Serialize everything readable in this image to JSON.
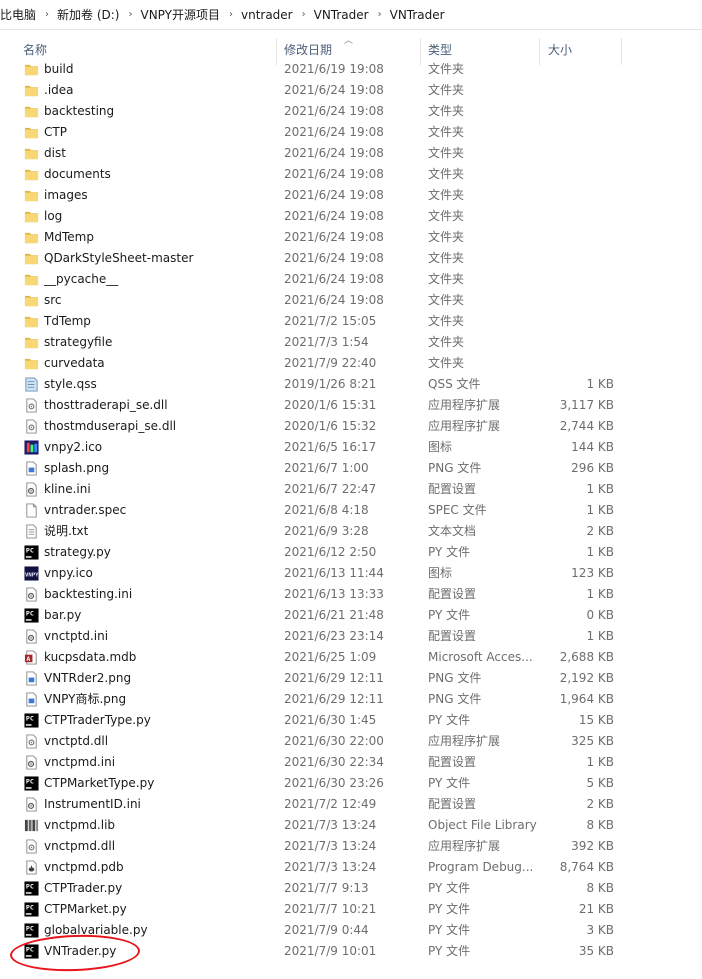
{
  "breadcrumb": [
    "比电脑",
    "新加卷 (D:)",
    "VNPY开源项目",
    "vntrader",
    "VNTrader",
    "VNTrader"
  ],
  "columns": {
    "name": "名称",
    "date": "修改日期",
    "type": "类型",
    "size": "大小"
  },
  "files": [
    {
      "name": "build",
      "date": "2021/6/19 19:08",
      "type": "文件夹",
      "size": "",
      "icon": "folder-icon"
    },
    {
      "name": ".idea",
      "date": "2021/6/24 19:08",
      "type": "文件夹",
      "size": "",
      "icon": "folder-icon"
    },
    {
      "name": "backtesting",
      "date": "2021/6/24 19:08",
      "type": "文件夹",
      "size": "",
      "icon": "folder-icon"
    },
    {
      "name": "CTP",
      "date": "2021/6/24 19:08",
      "type": "文件夹",
      "size": "",
      "icon": "folder-icon"
    },
    {
      "name": "dist",
      "date": "2021/6/24 19:08",
      "type": "文件夹",
      "size": "",
      "icon": "folder-icon"
    },
    {
      "name": "documents",
      "date": "2021/6/24 19:08",
      "type": "文件夹",
      "size": "",
      "icon": "folder-icon"
    },
    {
      "name": "images",
      "date": "2021/6/24 19:08",
      "type": "文件夹",
      "size": "",
      "icon": "folder-icon"
    },
    {
      "name": "log",
      "date": "2021/6/24 19:08",
      "type": "文件夹",
      "size": "",
      "icon": "folder-icon"
    },
    {
      "name": "MdTemp",
      "date": "2021/6/24 19:08",
      "type": "文件夹",
      "size": "",
      "icon": "folder-icon"
    },
    {
      "name": "QDarkStyleSheet-master",
      "date": "2021/6/24 19:08",
      "type": "文件夹",
      "size": "",
      "icon": "folder-icon"
    },
    {
      "name": "__pycache__",
      "date": "2021/6/24 19:08",
      "type": "文件夹",
      "size": "",
      "icon": "folder-icon"
    },
    {
      "name": "src",
      "date": "2021/6/24 19:08",
      "type": "文件夹",
      "size": "",
      "icon": "folder-icon"
    },
    {
      "name": "TdTemp",
      "date": "2021/7/2 15:05",
      "type": "文件夹",
      "size": "",
      "icon": "folder-icon"
    },
    {
      "name": "strategyfile",
      "date": "2021/7/3 1:54",
      "type": "文件夹",
      "size": "",
      "icon": "folder-icon"
    },
    {
      "name": "curvedata",
      "date": "2021/7/9 22:40",
      "type": "文件夹",
      "size": "",
      "icon": "folder-icon"
    },
    {
      "name": "style.qss",
      "date": "2019/1/26 8:21",
      "type": "QSS 文件",
      "size": "1 KB",
      "icon": "qss-file-icon"
    },
    {
      "name": "thosttraderapi_se.dll",
      "date": "2020/1/6 15:31",
      "type": "应用程序扩展",
      "size": "3,117 KB",
      "icon": "dll-file-icon"
    },
    {
      "name": "thostmduserapi_se.dll",
      "date": "2020/1/6 15:32",
      "type": "应用程序扩展",
      "size": "2,744 KB",
      "icon": "dll-file-icon"
    },
    {
      "name": "vnpy2.ico",
      "date": "2021/6/5 16:17",
      "type": "图标",
      "size": "144 KB",
      "icon": "ico-file-icon"
    },
    {
      "name": "splash.png",
      "date": "2021/6/7 1:00",
      "type": "PNG 文件",
      "size": "296 KB",
      "icon": "png-file-icon"
    },
    {
      "name": "kline.ini",
      "date": "2021/6/7 22:47",
      "type": "配置设置",
      "size": "1 KB",
      "icon": "ini-file-icon"
    },
    {
      "name": "vntrader.spec",
      "date": "2021/6/8 4:18",
      "type": "SPEC 文件",
      "size": "1 KB",
      "icon": "generic-file-icon"
    },
    {
      "name": "说明.txt",
      "date": "2021/6/9 3:28",
      "type": "文本文档",
      "size": "2 KB",
      "icon": "txt-file-icon"
    },
    {
      "name": "strategy.py",
      "date": "2021/6/12 2:50",
      "type": "PY 文件",
      "size": "1 KB",
      "icon": "pycharm-file-icon"
    },
    {
      "name": "vnpy.ico",
      "date": "2021/6/13 11:44",
      "type": "图标",
      "size": "123 KB",
      "icon": "vnpy-ico-file-icon"
    },
    {
      "name": "backtesting.ini",
      "date": "2021/6/13 13:33",
      "type": "配置设置",
      "size": "1 KB",
      "icon": "ini-file-icon"
    },
    {
      "name": "bar.py",
      "date": "2021/6/21 21:48",
      "type": "PY 文件",
      "size": "0 KB",
      "icon": "pycharm-file-icon"
    },
    {
      "name": "vnctptd.ini",
      "date": "2021/6/23 23:14",
      "type": "配置设置",
      "size": "1 KB",
      "icon": "ini-file-icon"
    },
    {
      "name": "kucpsdata.mdb",
      "date": "2021/6/25 1:09",
      "type": "Microsoft Acces...",
      "size": "2,688 KB",
      "icon": "access-file-icon"
    },
    {
      "name": "VNTRder2.png",
      "date": "2021/6/29 12:11",
      "type": "PNG 文件",
      "size": "2,192 KB",
      "icon": "png-file-icon"
    },
    {
      "name": "VNPY商标.png",
      "date": "2021/6/29 12:11",
      "type": "PNG 文件",
      "size": "1,964 KB",
      "icon": "png-file-icon"
    },
    {
      "name": "CTPTraderType.py",
      "date": "2021/6/30 1:45",
      "type": "PY 文件",
      "size": "15 KB",
      "icon": "pycharm-file-icon"
    },
    {
      "name": "vnctptd.dll",
      "date": "2021/6/30 22:00",
      "type": "应用程序扩展",
      "size": "325 KB",
      "icon": "dll-file-icon"
    },
    {
      "name": "vnctpmd.ini",
      "date": "2021/6/30 22:34",
      "type": "配置设置",
      "size": "1 KB",
      "icon": "ini-file-icon"
    },
    {
      "name": "CTPMarketType.py",
      "date": "2021/6/30 23:26",
      "type": "PY 文件",
      "size": "5 KB",
      "icon": "pycharm-file-icon"
    },
    {
      "name": "InstrumentID.ini",
      "date": "2021/7/2 12:49",
      "type": "配置设置",
      "size": "2 KB",
      "icon": "ini-file-icon"
    },
    {
      "name": "vnctpmd.lib",
      "date": "2021/7/3 13:24",
      "type": "Object File Library",
      "size": "8 KB",
      "icon": "lib-file-icon"
    },
    {
      "name": "vnctpmd.dll",
      "date": "2021/7/3 13:24",
      "type": "应用程序扩展",
      "size": "392 KB",
      "icon": "dll-file-icon"
    },
    {
      "name": "vnctpmd.pdb",
      "date": "2021/7/3 13:24",
      "type": "Program Debug...",
      "size": "8,764 KB",
      "icon": "pdb-file-icon"
    },
    {
      "name": "CTPTrader.py",
      "date": "2021/7/7 9:13",
      "type": "PY 文件",
      "size": "8 KB",
      "icon": "pycharm-file-icon"
    },
    {
      "name": "CTPMarket.py",
      "date": "2021/7/7 10:21",
      "type": "PY 文件",
      "size": "21 KB",
      "icon": "pycharm-file-icon"
    },
    {
      "name": "globalvariable.py",
      "date": "2021/7/9 0:44",
      "type": "PY 文件",
      "size": "3 KB",
      "icon": "pycharm-file-icon"
    },
    {
      "name": "VNTrader.py",
      "date": "2021/7/9 10:01",
      "type": "PY 文件",
      "size": "35 KB",
      "icon": "pycharm-file-icon"
    }
  ],
  "colors": {
    "folder": "#f8d775",
    "folder_dark": "#e0b43f",
    "highlight": "#e8141b",
    "header_text": "#4c607a"
  }
}
